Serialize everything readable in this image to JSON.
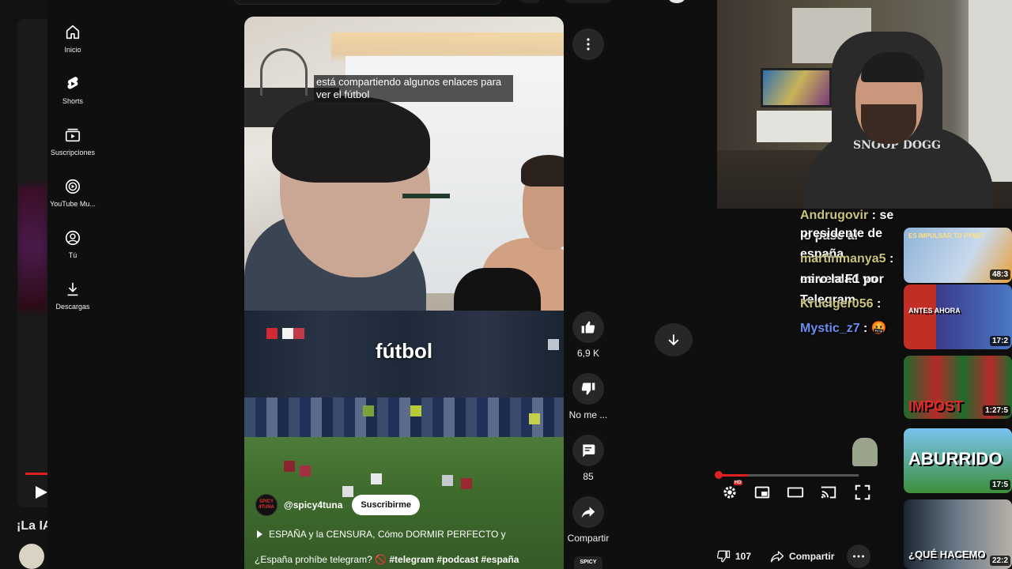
{
  "left_page": {
    "title_partial": "¡La IA"
  },
  "sidebar": {
    "items": [
      {
        "label": "Inicio",
        "icon": "home-icon"
      },
      {
        "label": "Shorts",
        "icon": "shorts-icon"
      },
      {
        "label": "Suscripciones",
        "icon": "subscriptions-icon"
      },
      {
        "label": "YouTube Mu...",
        "icon": "youtube-music-icon"
      },
      {
        "label": "Tú",
        "icon": "you-icon"
      },
      {
        "label": "Descargas",
        "icon": "download-icon"
      }
    ]
  },
  "short": {
    "caption": "está compartiendo algunos enlaces para ver el fútbol",
    "overlay_word": "fútbol",
    "channel_handle": "@spicy4tuna",
    "channel_avatar_text": "SPICY 4TUNA",
    "subscribe_label": "Suscribirme",
    "title": "ESPAÑA y la CENSURA, Cómo DORMIR PERFECTO y",
    "hashtags_line_prefix": "¿España prohíbe telegram? 🚫 ",
    "hashtags": "#telegram #podcast #españa",
    "actions": {
      "like_count": "6,9 K",
      "dislike_label": "No me ...",
      "comments_count": "85",
      "share_label": "Compartir"
    },
    "channel_mini_text": "SPICY"
  },
  "stream": {
    "shirt_text": "SNOOP DOGG",
    "chat": [
      {
        "user": "Andrugovir",
        "message": " : se lo pase al",
        "continuation": "presidente de españa",
        "color": "yellow"
      },
      {
        "user": "martinmanya5",
        "message": " : es verdad yo",
        "continuation": "miro la F1 por Telegram",
        "color": "yellow"
      },
      {
        "user": "Kruciger056",
        "message": " :",
        "continuation": "",
        "color": "yellow"
      },
      {
        "user": "Mystic_z7",
        "message": " : 🤬",
        "continuation": "",
        "color": "blue"
      }
    ],
    "dislike_count": "107",
    "share_label": "Compartir",
    "hd_badge": "HD"
  },
  "sidebar_thumbs": [
    {
      "duration": "48:3",
      "overlay": "ES IMPULSAR TU PYME?"
    },
    {
      "duration": "17:2",
      "overlay": "ANTES AHORA"
    },
    {
      "duration": "1:27:5",
      "overlay": "IMPOST"
    },
    {
      "duration": "17:5",
      "overlay": "ABURRIDO"
    },
    {
      "duration": "22:2",
      "overlay": "¿QUÉ HACEMO"
    }
  ],
  "colors": {
    "accent_red": "#e02020",
    "chat_user_yellow": "#c9c47a",
    "chat_user_blue": "#6b8ef2"
  }
}
